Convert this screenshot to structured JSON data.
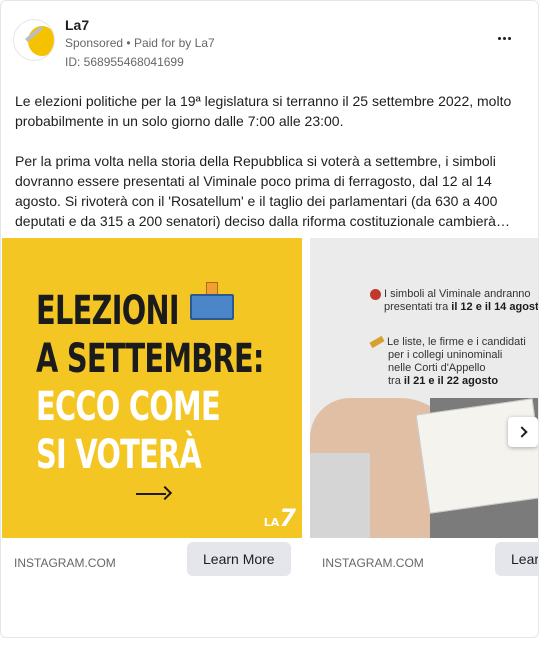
{
  "ad": {
    "page_name": "La7",
    "sponsored": "Sponsored",
    "separator": "•",
    "paid_for_by": "Paid for by",
    "payer": "La7",
    "id": "ID: 568955468041699"
  },
  "body": {
    "paragraph1": "Le elezioni politiche per la 19ª legislatura si terranno il 25 settembre 2022, molto probabilmente in un solo giorno dalle 7:00 alle 23:00.",
    "paragraph2": "Per la prima volta nella storia della Repubblica si voterà a settembre, i simboli dovranno essere presentati al Viminale poco prima di ferragosto, dal 12 al 14 agosto. Si rivoterà con il 'Rosatellum' e il taglio dei parlamentari (da 630 a 400 deputati e da 315 a 200 senatori) deciso dalla riforma costituzionale cambierà…"
  },
  "cards": [
    {
      "headline_lines": [
        "ELEZIONI",
        "A SETTEMBRE:",
        "ECCO COME",
        "SI VOTERÀ"
      ],
      "logo_small": "LA",
      "logo_big": "7",
      "domain": "INSTAGRAM.COM",
      "cta": "Learn More"
    },
    {
      "line1a": "I simboli al Viminale andranno",
      "line1b_pre": "presentati tra ",
      "line1b_bold": "il 12 e il 14 agosto",
      "line2a": "Le liste, le firme e i candidati",
      "line2b": "per i collegi uninominali",
      "line2c": "nelle Corti d'Appello",
      "line2d_pre": "tra ",
      "line2d_bold": "il 21 e il 22 agosto",
      "domain": "INSTAGRAM.COM",
      "cta": "Learn More"
    }
  ],
  "colors": {
    "slide1_bg": "#f3c624",
    "accent_blue": "#4a86c8"
  },
  "icons": [
    "more-options-icon",
    "ballot-box-icon",
    "arrow-right-icon",
    "chevron-right-icon",
    "red-globe-icon",
    "pen-icon"
  ]
}
